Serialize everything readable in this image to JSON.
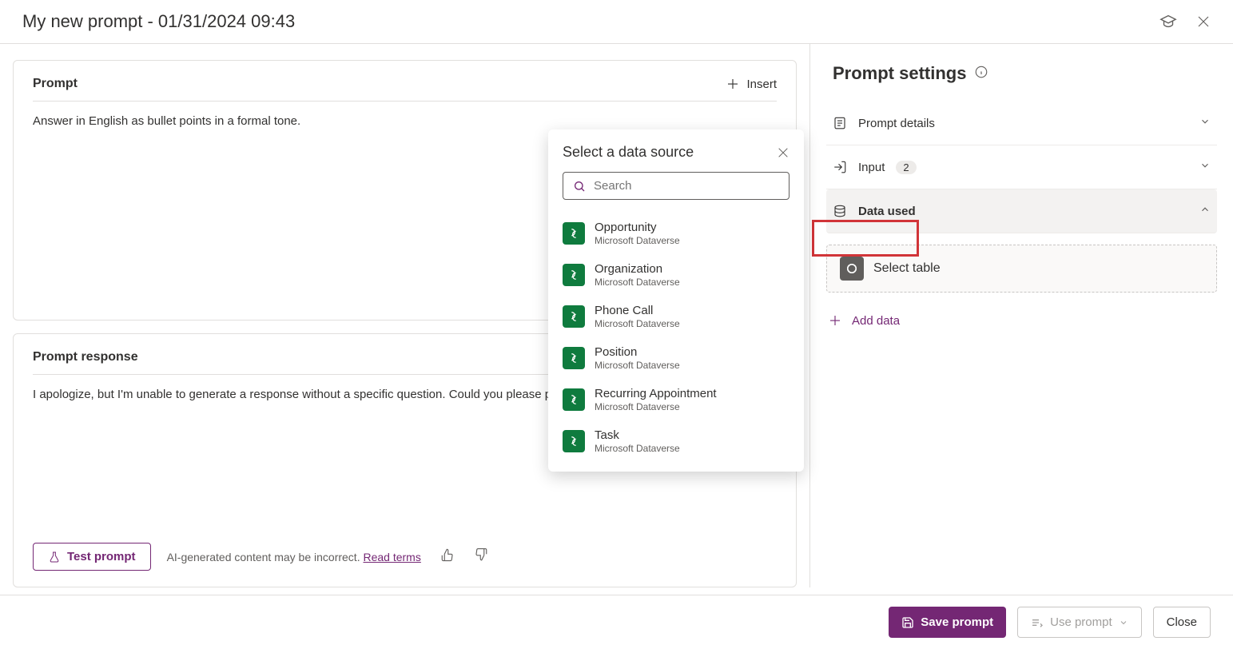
{
  "header": {
    "title": "My new prompt - 01/31/2024 09:43"
  },
  "prompt": {
    "card_title": "Prompt",
    "insert_label": "Insert",
    "text": "Answer in English as bullet points in a formal tone."
  },
  "response": {
    "card_title": "Prompt response",
    "text": "I apologize, but I'm unable to generate a response without a specific question. Could you please provide",
    "test_label": "Test prompt",
    "disclaimer": "AI-generated content may be incorrect.",
    "terms_label": "Read terms"
  },
  "settings": {
    "title": "Prompt settings",
    "details_label": "Prompt details",
    "input_label": "Input",
    "input_count": "2",
    "data_used_label": "Data used",
    "select_table_label": "Select table",
    "add_data_label": "Add data"
  },
  "popover": {
    "title": "Select a data source",
    "search_placeholder": "Search",
    "items": [
      {
        "name": "Opportunity",
        "source": "Microsoft Dataverse"
      },
      {
        "name": "Organization",
        "source": "Microsoft Dataverse"
      },
      {
        "name": "Phone Call",
        "source": "Microsoft Dataverse"
      },
      {
        "name": "Position",
        "source": "Microsoft Dataverse"
      },
      {
        "name": "Recurring Appointment",
        "source": "Microsoft Dataverse"
      },
      {
        "name": "Task",
        "source": "Microsoft Dataverse"
      }
    ]
  },
  "footer": {
    "save_label": "Save prompt",
    "use_label": "Use prompt",
    "close_label": "Close"
  }
}
